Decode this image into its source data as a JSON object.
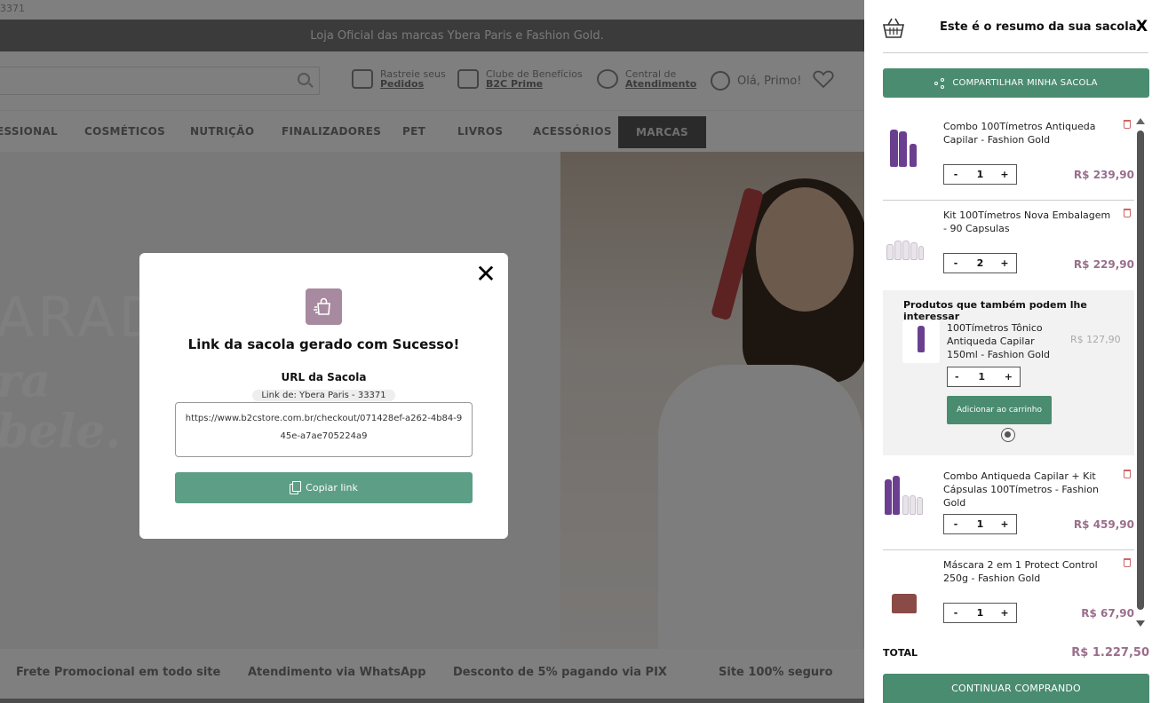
{
  "page": {
    "corner_code": "3371",
    "announcement": "Loja Oficial das marcas Ybera Paris e Fashion Gold.",
    "header": {
      "track_line1": "Rastreie seus",
      "track_line2": "Pedidos",
      "club_line1": "Clube de Benefícios",
      "club_line2": "B2C Prime",
      "support_line1": "Central de",
      "support_line2": "Atendimento",
      "greeting": "Olá, Primo!"
    },
    "nav": [
      "ESSIONAL",
      "COSMÉTICOS",
      "NUTRIÇÃO",
      "FINALIZADORES",
      "PET",
      "LIVROS",
      "ACESSÓRIOS",
      "MARCAS"
    ],
    "hero": {
      "line1": "ARAD",
      "line2": "ra",
      "line3": "bele."
    },
    "benefits": [
      "Frete Promocional em todo site",
      "Atendimento via WhatsApp",
      "Desconto de 5% pagando via PIX",
      "Site 100% seguro"
    ]
  },
  "modal": {
    "title": "Link da sacola gerado com Sucesso!",
    "url_label": "URL da Sacola",
    "link_of": "Link de: Ybera Paris - 33371",
    "url": "https://www.b2cstore.com.br/checkout/071428ef-a262-4b84-945e-a7ae705224a9",
    "copy_label": "Copiar link",
    "close_glyph": "✕"
  },
  "drawer": {
    "title": "Este é o resumo da sua sacola",
    "close_label": "X",
    "share_label": "COMPARTILHAR MINHA SACOLA",
    "items": [
      {
        "name": "Combo 100Tímetros Antiqueda Capilar - Fashion Gold",
        "qty": "1",
        "price": "R$ 239,90"
      },
      {
        "name": "Kit 100Tímetros Nova Embalagem - 90 Capsulas",
        "qty": "2",
        "price": "R$ 229,90"
      },
      {
        "name": "Combo Antiqueda Capilar + Kit Cápsulas 100Tímetros - Fashion Gold",
        "qty": "1",
        "price": "R$ 459,90"
      },
      {
        "name": "Máscara 2 em 1 Protect Control 250g - Fashion Gold",
        "qty": "1",
        "price": "R$ 67,90"
      }
    ],
    "recommendations": {
      "title": "Produtos que também podem lhe interessar",
      "product": {
        "name": "100Tímetros Tônico Antiqueda Capilar 150ml - Fashion Gold",
        "price": "R$ 127,90",
        "qty": "1"
      },
      "add_label": "Adicionar ao carrinho"
    },
    "qty_minus": "-",
    "qty_plus": "+",
    "total_label": "TOTAL",
    "total_value": "R$ 1.227,50",
    "continue_label": "CONTINUAR COMPRANDO"
  },
  "colors": {
    "accent_green": "#4a8c70",
    "price_mauve": "#9a6e8c",
    "modal_icon": "#a78a9f"
  }
}
